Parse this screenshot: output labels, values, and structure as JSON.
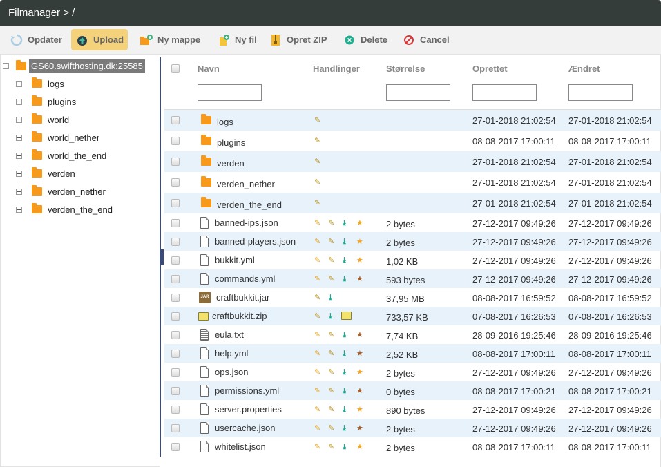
{
  "window": {
    "title": "Filmanager > /"
  },
  "toolbar": {
    "refresh": "Opdater",
    "upload": "Upload",
    "new_folder": "Ny mappe",
    "new_file": "Ny fil",
    "create_zip": "Opret ZIP",
    "delete": "Delete",
    "cancel": "Cancel"
  },
  "tree": {
    "root": "GS60.swifthosting.dk:25585",
    "items": [
      "logs",
      "plugins",
      "world",
      "world_nether",
      "world_the_end",
      "verden",
      "verden_nether",
      "verden_the_end"
    ]
  },
  "columns": {
    "name": "Navn",
    "actions": "Handlinger",
    "size": "Størrelse",
    "created": "Oprettet",
    "modified": "Ændret"
  },
  "files": [
    {
      "name": "logs",
      "type": "folder",
      "size": "",
      "created": "27-01-2018 21:02:54",
      "modified": "27-01-2018 21:02:54"
    },
    {
      "name": "plugins",
      "type": "folder",
      "size": "",
      "created": "08-08-2017 17:00:11",
      "modified": "08-08-2017 17:00:11"
    },
    {
      "name": "verden",
      "type": "folder",
      "size": "",
      "created": "27-01-2018 21:02:54",
      "modified": "27-01-2018 21:02:54"
    },
    {
      "name": "verden_nether",
      "type": "folder",
      "size": "",
      "created": "27-01-2018 21:02:54",
      "modified": "27-01-2018 21:02:54"
    },
    {
      "name": "verden_the_end",
      "type": "folder",
      "size": "",
      "created": "27-01-2018 21:02:54",
      "modified": "27-01-2018 21:02:54"
    },
    {
      "name": "banned-ips.json",
      "type": "file",
      "star": "yellow",
      "size": "2 bytes",
      "created": "27-12-2017 09:49:26",
      "modified": "27-12-2017 09:49:26"
    },
    {
      "name": "banned-players.json",
      "type": "file",
      "star": "yellow",
      "size": "2 bytes",
      "created": "27-12-2017 09:49:26",
      "modified": "27-12-2017 09:49:26"
    },
    {
      "name": "bukkit.yml",
      "type": "file",
      "star": "yellow",
      "size": "1,02 KB",
      "created": "27-12-2017 09:49:26",
      "modified": "27-12-2017 09:49:26"
    },
    {
      "name": "commands.yml",
      "type": "file",
      "star": "brown",
      "size": "593 bytes",
      "created": "27-12-2017 09:49:26",
      "modified": "27-12-2017 09:49:26"
    },
    {
      "name": "craftbukkit.jar",
      "type": "jar",
      "size": "37,95 MB",
      "created": "08-08-2017 16:59:52",
      "modified": "08-08-2017 16:59:52"
    },
    {
      "name": "craftbukkit.zip",
      "type": "zip",
      "size": "733,57 KB",
      "created": "07-08-2017 16:26:53",
      "modified": "07-08-2017 16:26:53"
    },
    {
      "name": "eula.txt",
      "type": "text",
      "star": "brown",
      "size": "7,74 KB",
      "created": "28-09-2016 19:25:46",
      "modified": "28-09-2016 19:25:46"
    },
    {
      "name": "help.yml",
      "type": "file",
      "star": "brown",
      "size": "2,52 KB",
      "created": "08-08-2017 17:00:11",
      "modified": "08-08-2017 17:00:11"
    },
    {
      "name": "ops.json",
      "type": "file",
      "star": "yellow",
      "size": "2 bytes",
      "created": "27-12-2017 09:49:26",
      "modified": "27-12-2017 09:49:26"
    },
    {
      "name": "permissions.yml",
      "type": "file",
      "star": "brown",
      "size": "0 bytes",
      "created": "08-08-2017 17:00:21",
      "modified": "08-08-2017 17:00:21"
    },
    {
      "name": "server.properties",
      "type": "file",
      "star": "yellow",
      "size": "890 bytes",
      "created": "27-12-2017 09:49:26",
      "modified": "27-12-2017 09:49:26"
    },
    {
      "name": "usercache.json",
      "type": "file",
      "star": "brown",
      "size": "2 bytes",
      "created": "27-12-2017 09:49:26",
      "modified": "27-12-2017 09:49:26"
    },
    {
      "name": "whitelist.json",
      "type": "file",
      "star": "yellow",
      "size": "2 bytes",
      "created": "08-08-2017 17:00:11",
      "modified": "08-08-2017 17:00:11"
    }
  ],
  "colors": {
    "titlebar": "#353d3b",
    "upload_highlight": "#f4d27c",
    "folder": "#f79a1b",
    "row_alt": "#e8f2fb"
  }
}
